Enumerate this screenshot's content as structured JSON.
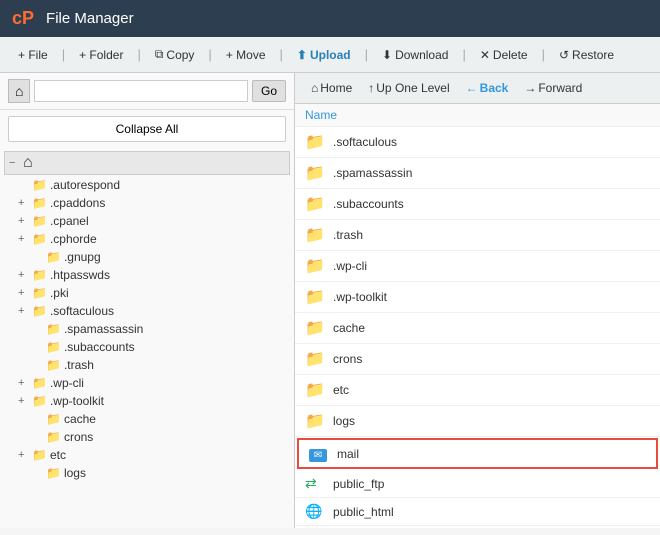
{
  "header": {
    "logo": "cP",
    "title": "File Manager"
  },
  "toolbar": {
    "file_label": "+ File",
    "folder_label": "+ Folder",
    "copy_label": "Copy",
    "move_label": "+ Move",
    "upload_label": "Upload",
    "download_label": "Download",
    "delete_label": "Delete",
    "restore_label": "Restore"
  },
  "left_panel": {
    "go_label": "Go",
    "collapse_all_label": "Collapse All",
    "home_icon": "⌂",
    "tree_items": [
      {
        "id": "root",
        "label": "⌂",
        "indent": 0,
        "toggle": "−",
        "is_root": true
      },
      {
        "id": "autorespond",
        "label": ".autorespond",
        "indent": 1,
        "toggle": ""
      },
      {
        "id": "cpaddons",
        "label": ".cpaddons",
        "indent": 1,
        "toggle": "+"
      },
      {
        "id": "cpanel",
        "label": ".cpanel",
        "indent": 1,
        "toggle": "+"
      },
      {
        "id": "cphorde",
        "label": ".cphorde",
        "indent": 1,
        "toggle": "+"
      },
      {
        "id": "gnupg",
        "label": ".gnupg",
        "indent": 2,
        "toggle": ""
      },
      {
        "id": "htpasswds",
        "label": ".htpasswds",
        "indent": 1,
        "toggle": "+"
      },
      {
        "id": "pki",
        "label": ".pki",
        "indent": 1,
        "toggle": "+"
      },
      {
        "id": "softaculous",
        "label": ".softaculous",
        "indent": 1,
        "toggle": "+"
      },
      {
        "id": "spamassassin",
        "label": ".spamassassin",
        "indent": 2,
        "toggle": ""
      },
      {
        "id": "subaccounts",
        "label": ".subaccounts",
        "indent": 2,
        "toggle": ""
      },
      {
        "id": "trash",
        "label": ".trash",
        "indent": 2,
        "toggle": ""
      },
      {
        "id": "wp-cli",
        "label": ".wp-cli",
        "indent": 1,
        "toggle": "+"
      },
      {
        "id": "wp-toolkit",
        "label": ".wp-toolkit",
        "indent": 1,
        "toggle": "+"
      },
      {
        "id": "cache",
        "label": "cache",
        "indent": 2,
        "toggle": ""
      },
      {
        "id": "crons",
        "label": "crons",
        "indent": 2,
        "toggle": ""
      },
      {
        "id": "etc",
        "label": "etc",
        "indent": 1,
        "toggle": "+"
      },
      {
        "id": "logs",
        "label": "logs",
        "indent": 2,
        "toggle": ""
      }
    ]
  },
  "right_panel": {
    "nav": {
      "home_label": "Home",
      "up_one_level_label": "Up One Level",
      "back_label": "Back",
      "forward_label": "Forward"
    },
    "column_name": "Name",
    "files": [
      {
        "id": "softaculous",
        "name": ".softaculous",
        "type": "folder",
        "icon": "folder"
      },
      {
        "id": "spamassassin",
        "name": ".spamassassin",
        "type": "folder",
        "icon": "folder"
      },
      {
        "id": "subaccounts",
        "name": ".subaccounts",
        "type": "folder",
        "icon": "folder"
      },
      {
        "id": "trash",
        "name": ".trash",
        "type": "folder",
        "icon": "folder"
      },
      {
        "id": "wp-cli",
        "name": ".wp-cli",
        "type": "folder",
        "icon": "folder"
      },
      {
        "id": "wp-toolkit",
        "name": ".wp-toolkit",
        "type": "folder",
        "icon": "folder"
      },
      {
        "id": "cache",
        "name": "cache",
        "type": "folder",
        "icon": "folder"
      },
      {
        "id": "crons",
        "name": "crons",
        "type": "folder",
        "icon": "folder"
      },
      {
        "id": "etc",
        "name": "etc",
        "type": "folder",
        "icon": "folder"
      },
      {
        "id": "logs",
        "name": "logs",
        "type": "folder",
        "icon": "folder"
      },
      {
        "id": "mail",
        "name": "mail",
        "type": "mail",
        "icon": "mail",
        "selected": true
      },
      {
        "id": "public_ftp",
        "name": "public_ftp",
        "type": "ftp",
        "icon": "ftp"
      },
      {
        "id": "public_html",
        "name": "public_html",
        "type": "html",
        "icon": "html"
      }
    ]
  }
}
